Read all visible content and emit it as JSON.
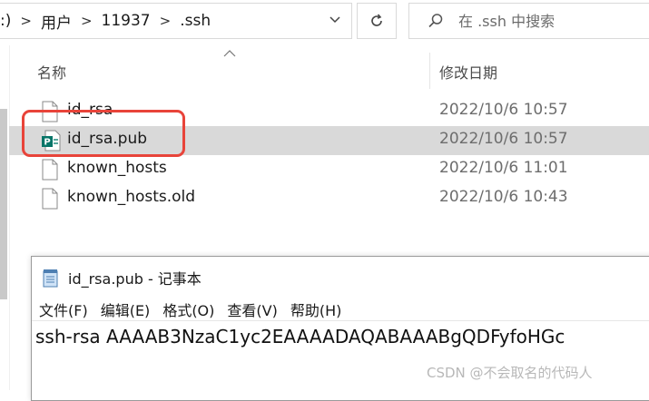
{
  "explorer": {
    "breadcrumb": [
      ":)",
      "用户",
      "11937",
      ".ssh"
    ],
    "search_placeholder": "在 .ssh 中搜索",
    "columns": {
      "name": "名称",
      "date_modified": "修改日期"
    },
    "files": [
      {
        "name": "id_rsa",
        "date": "2022/10/6 10:57",
        "icon": "file-icon"
      },
      {
        "name": "id_rsa.pub",
        "date": "2022/10/6 10:57",
        "icon": "publisher-file-icon"
      },
      {
        "name": "known_hosts",
        "date": "2022/10/6 11:01",
        "icon": "file-icon"
      },
      {
        "name": "known_hosts.old",
        "date": "2022/10/6 10:43",
        "icon": "file-icon"
      }
    ],
    "colors": {
      "selection": "#d9d9d9",
      "highlight_border": "#e8443a"
    }
  },
  "notepad": {
    "title": "id_rsa.pub - 记事本",
    "menu": [
      "文件(F)",
      "编辑(E)",
      "格式(O)",
      "查看(V)",
      "帮助(H)"
    ],
    "content": "ssh-rsa AAAAB3NzaC1yc2EAAAADAQABAAABgQDFyfoHGc"
  },
  "watermark": "CSDN @不会取名的代码人"
}
